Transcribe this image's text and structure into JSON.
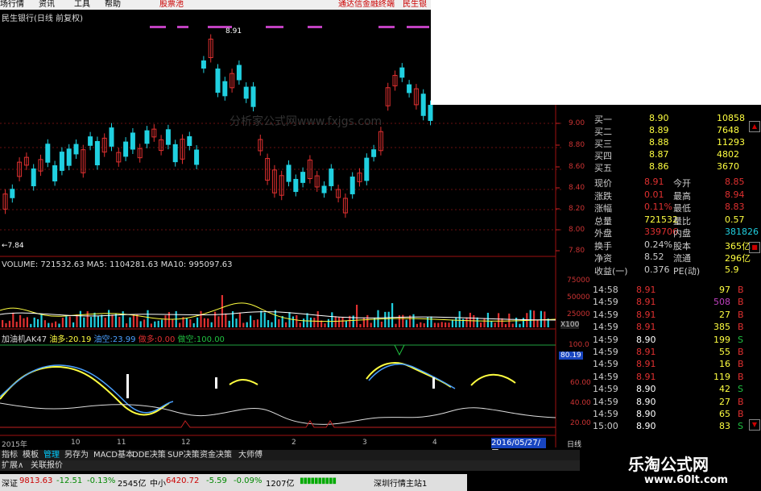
{
  "menu": {
    "items": [
      "场行情",
      "资讯",
      "工具",
      "帮助"
    ],
    "stock_tag": "股票池",
    "extra1": "通达信金融终端",
    "extra2": "民生银"
  },
  "chart": {
    "title": "民生银行(日线 前复权)",
    "high_label": "8.91",
    "low_label": "←7.84",
    "watermark": "分析家公式网www.fxjgs.com",
    "right_price_ticks": [
      "9.00",
      "8.80",
      "8.60",
      "8.40",
      "8.20",
      "8.00",
      "7.80"
    ]
  },
  "volume": {
    "label": "VOLUME: 721532.63 MA5: 1104281.63 MA10: 995097.63",
    "ticks": [
      "75000",
      "50000",
      "25000"
    ],
    "unit": "X100"
  },
  "indicator": {
    "name": "加油机AK47",
    "duo_lbl": "油多:",
    "duo_val": "20.19",
    "kong_lbl": "油空:",
    "kong_val": "23.99",
    "duo2_lbl": "做多:",
    "duo2_val": "0.00",
    "kong2_lbl": "做空:",
    "kong2_val": "100.00",
    "ticks": [
      "100.0",
      "80.19",
      "60.00",
      "40.00",
      "20.00"
    ]
  },
  "xaxis": {
    "labels": [
      "2015年",
      "10",
      "11",
      "12",
      "2",
      "3",
      "4"
    ],
    "date": "2016/05/27/五",
    "period": "日线"
  },
  "quote": {
    "rows": [
      {
        "l": "买一",
        "v": "8.90",
        "v2": "10858"
      },
      {
        "l": "买二",
        "v": "8.89",
        "v2": "7648"
      },
      {
        "l": "买三",
        "v": "8.88",
        "v2": "11293"
      },
      {
        "l": "买四",
        "v": "8.87",
        "v2": "4802"
      },
      {
        "l": "买五",
        "v": "8.86",
        "v2": "3670"
      }
    ],
    "stats": [
      {
        "l": "现价",
        "v": "8.91",
        "l2": "今开",
        "v2": "8.85"
      },
      {
        "l": "涨跌",
        "v": "0.01",
        "l2": "最高",
        "v2": "8.94"
      },
      {
        "l": "涨幅",
        "v": "0.11%",
        "l2": "最低",
        "v2": "8.83"
      },
      {
        "l": "总量",
        "v": "721532",
        "l2": "量比",
        "v2": "0.57"
      },
      {
        "l": "外盘",
        "v": "339706",
        "l2": "内盘",
        "v2": "381826"
      },
      {
        "l": "换手",
        "v": "0.24%",
        "l2": "股本",
        "v2": "365亿"
      },
      {
        "l": "净资",
        "v": "8.52",
        "l2": "流通",
        "v2": "296亿"
      },
      {
        "l": "收益(一)",
        "v": "0.376",
        "l2": "PE(动)",
        "v2": "5.9"
      }
    ]
  },
  "ticks": [
    {
      "t": "14:58",
      "p": "8.91",
      "v": "97",
      "s": "B"
    },
    {
      "t": "14:59",
      "p": "8.91",
      "v": "508",
      "s": "B"
    },
    {
      "t": "14:59",
      "p": "8.91",
      "v": "27",
      "s": "B"
    },
    {
      "t": "14:59",
      "p": "8.91",
      "v": "385",
      "s": "B"
    },
    {
      "t": "14:59",
      "p": "8.90",
      "v": "199",
      "s": "S"
    },
    {
      "t": "14:59",
      "p": "8.91",
      "v": "55",
      "s": "B"
    },
    {
      "t": "14:59",
      "p": "8.91",
      "v": "16",
      "s": "B"
    },
    {
      "t": "14:59",
      "p": "8.91",
      "v": "119",
      "s": "B"
    },
    {
      "t": "14:59",
      "p": "8.90",
      "v": "42",
      "s": "S"
    },
    {
      "t": "14:59",
      "p": "8.90",
      "v": "27",
      "s": "B"
    },
    {
      "t": "14:59",
      "p": "8.90",
      "v": "65",
      "s": "B"
    },
    {
      "t": "15:00",
      "p": "8.90",
      "v": "83",
      "s": "S"
    }
  ],
  "tabs": [
    "指标",
    "模板",
    "管理",
    "另存为",
    "MACD基本",
    "DDE决策",
    "SUP决策",
    "资金决策",
    "大师傅"
  ],
  "tabs2": [
    "扩展∧",
    "关联报价"
  ],
  "status": {
    "sz": "深证",
    "sz_val": "9813.63",
    "sz_chg": "-12.51",
    "sz_pct": "-0.13%",
    "sz_amt": "2545亿",
    "zx": "中小",
    "zx_val": "6420.72",
    "zx_chg": "-5.59",
    "zx_pct": "-0.09%",
    "zx_amt": "1207亿",
    "feed": "深圳行情主站1"
  },
  "brand": {
    "cn": "乐淘公式网",
    "url": "www.60lt.com"
  },
  "colors": {
    "up": "#e03030",
    "down": "#20d0e0",
    "yellow": "#ffff40",
    "white": "#ffffff"
  }
}
